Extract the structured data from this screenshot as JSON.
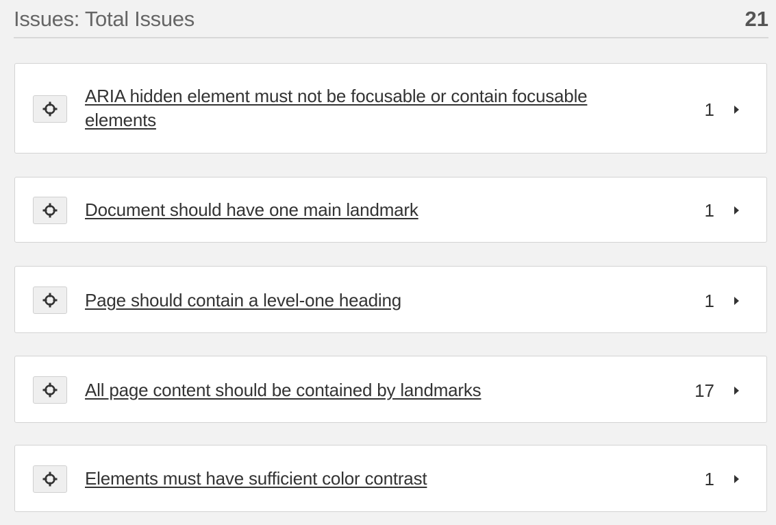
{
  "header": {
    "title": "Issues: Total Issues",
    "total": "21"
  },
  "icons": {
    "target": "crosshair-target-icon",
    "expand": "chevron-right-icon"
  },
  "issues": [
    {
      "title": "ARIA hidden element must not be focusable or contain focusable elements",
      "count": "1"
    },
    {
      "title": "Document should have one main landmark",
      "count": "1"
    },
    {
      "title": "Page should contain a level-one heading",
      "count": "1"
    },
    {
      "title": "All page content should be contained by landmarks",
      "count": "17"
    },
    {
      "title": "Elements must have sufficient color contrast",
      "count": "1"
    }
  ]
}
